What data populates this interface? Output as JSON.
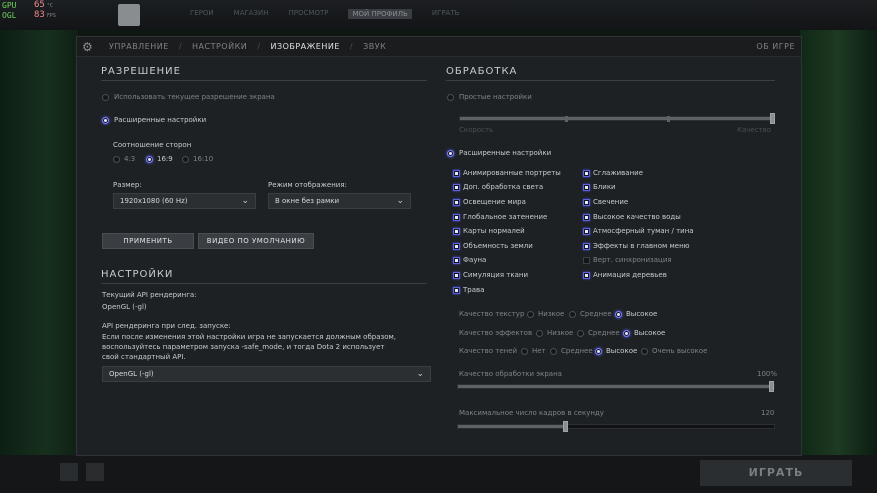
{
  "hud": {
    "gpu_label": "GPU",
    "gpu_value": "65",
    "gpu_unit": "°C",
    "api_label": "OGL",
    "fps_value": "83",
    "fps_unit": "FPS"
  },
  "topnav": {
    "items": [
      "ГЕРОИ",
      "МАГАЗИН",
      "ПРОСМОТР",
      "МОЙ ПРОФИЛЬ",
      "ИГРАТЬ"
    ]
  },
  "tabs": {
    "items": [
      "УПРАВЛЕНИЕ",
      "НАСТРОЙКИ",
      "ИЗОБРАЖЕНИЕ",
      "ЗВУК"
    ],
    "separator": "/",
    "active": "ИЗОБРАЖЕНИЕ",
    "about": "ОБ ИГРЕ"
  },
  "resolution": {
    "heading": "РАЗРЕШЕНИЕ",
    "use_current": "Использовать текущее разрешение экрана",
    "advanced": "Расширенные настройки",
    "aspect_label": "Соотношение сторон",
    "aspect_options": [
      "4:3",
      "16:9",
      "16:10"
    ],
    "aspect_selected": "16:9",
    "size_label": "Размер:",
    "size_value": "1920x1080 (60 Hz)",
    "display_mode_label": "Режим отображения:",
    "display_mode_value": "В окне без рамки",
    "apply_button": "ПРИМЕНИТЬ",
    "default_video_button": "ВИДЕО ПО УМОЛЧАНИЮ"
  },
  "settings": {
    "heading": "НАСТРОЙКИ",
    "current_api_label": "Текущий API рендеринга:",
    "current_api_value": "OpenGL (-gl)",
    "next_api_label": "API рендеринга при след. запуске:",
    "next_api_note_1": "Если после изменения этой настройки игра не запускается должным образом,",
    "next_api_note_2": "воспользуйтесь параметром запуска -safe_mode, и тогда Dota 2 использует",
    "next_api_note_3": "свой стандартный API.",
    "api_select_value": "OpenGL (-gl)"
  },
  "processing": {
    "heading": "ОБРАБОТКА",
    "simple": "Простые настройки",
    "speed_label": "Скорость",
    "quality_label": "Качество",
    "advanced": "Расширенные настройки",
    "left_options": [
      {
        "label": "Анимированные портреты",
        "checked": true
      },
      {
        "label": "Доп. обработка света",
        "checked": true
      },
      {
        "label": "Освещение мира",
        "checked": true
      },
      {
        "label": "Глобальное затенение",
        "checked": true
      },
      {
        "label": "Карты нормалей",
        "checked": true
      },
      {
        "label": "Объемность земли",
        "checked": true
      },
      {
        "label": "Фауна",
        "checked": true
      },
      {
        "label": "Симуляция ткани",
        "checked": true
      },
      {
        "label": "Трава",
        "checked": true
      }
    ],
    "right_options": [
      {
        "label": "Сглаживание",
        "checked": true
      },
      {
        "label": "Блики",
        "checked": true
      },
      {
        "label": "Свечение",
        "checked": true
      },
      {
        "label": "Высокое качество воды",
        "checked": true
      },
      {
        "label": "Атмосферный туман / тина",
        "checked": true
      },
      {
        "label": "Эффекты в главном меню",
        "checked": true
      },
      {
        "label": "Верт. синхронизация",
        "checked": false
      },
      {
        "label": "Анимация деревьев",
        "checked": true
      }
    ],
    "texture_label": "Качество текстур",
    "texture_options": [
      "Низкое",
      "Среднее",
      "Высокое"
    ],
    "texture_selected": "Высокое",
    "effects_label": "Качество эффектов",
    "effects_options": [
      "Низкое",
      "Среднее",
      "Высокое"
    ],
    "effects_selected": "Высокое",
    "shadows_label": "Качество теней",
    "shadows_options": [
      "Нет",
      "Среднее",
      "Высокое",
      "Очень высокое"
    ],
    "shadows_selected": "Высокое",
    "screen_quality_label": "Качество обработки экрана",
    "screen_quality_value": "100%",
    "screen_quality_fraction": 1.0,
    "max_fps_label": "Максимальное число кадров в секунду",
    "max_fps_value": "120",
    "max_fps_fraction": 0.34
  },
  "bottom": {
    "play_button": "ИГРАТЬ"
  }
}
